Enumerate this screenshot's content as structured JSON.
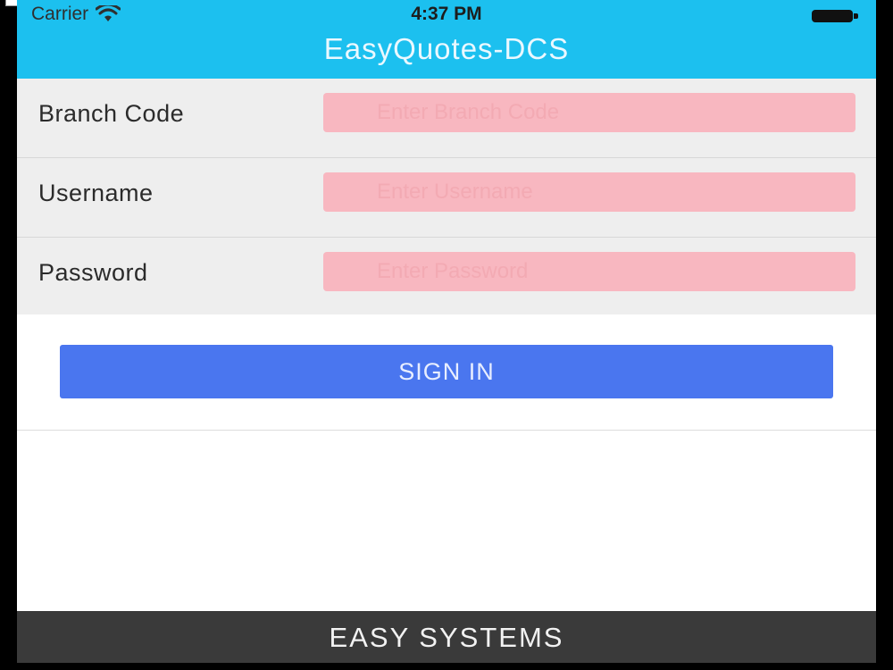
{
  "status_bar": {
    "carrier": "Carrier",
    "time": "4:37 PM",
    "wifi_icon": "wifi-icon",
    "battery_icon": "battery-icon"
  },
  "nav": {
    "title": "EasyQuotes-DCS"
  },
  "form": {
    "branch": {
      "label": "Branch Code",
      "placeholder": "Enter Branch Code",
      "value": ""
    },
    "username": {
      "label": "Username",
      "placeholder": "Enter Username",
      "value": ""
    },
    "password": {
      "label": "Password",
      "placeholder": "Enter Password",
      "value": ""
    }
  },
  "actions": {
    "sign_in_label": "SIGN IN"
  },
  "footer": {
    "text": "EASY SYSTEMS"
  },
  "colors": {
    "nav_bar": "#1cc0ef",
    "input_bg": "#f8b7c0",
    "button": "#4a76ef",
    "footer": "#3a3a3a"
  }
}
